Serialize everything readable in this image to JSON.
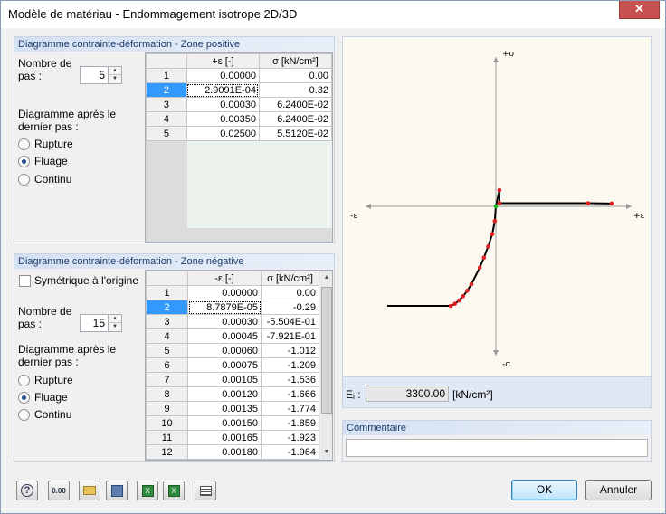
{
  "window": {
    "title": "Modèle de matériau - Endommagement isotrope 2D/3D",
    "close_glyph": "✕"
  },
  "positive": {
    "header": "Diagramme contrainte-déformation - Zone positive",
    "steps_label_1": "Nombre de",
    "steps_label_2": "pas :",
    "steps_value": "5",
    "after_label_1": "Diagramme après le",
    "after_label_2": "dernier pas :",
    "options": [
      "Rupture",
      "Fluage",
      "Continu"
    ],
    "selected_option": "Fluage",
    "columns": [
      "+ε [-]",
      "σ [kN/cm²]"
    ],
    "rows": [
      {
        "n": "1",
        "eps": "0.00000",
        "sigma": "0.00"
      },
      {
        "n": "2",
        "eps": "2.9091E-04",
        "sigma": "0.32"
      },
      {
        "n": "3",
        "eps": "0.00030",
        "sigma": "6.2400E-02"
      },
      {
        "n": "4",
        "eps": "0.00350",
        "sigma": "6.2400E-02"
      },
      {
        "n": "5",
        "eps": "0.02500",
        "sigma": "5.5120E-02"
      }
    ]
  },
  "negative": {
    "header": "Diagramme contrainte-déformation - Zone négative",
    "symmetric_label": "Symétrique à l'origine",
    "symmetric_checked": false,
    "steps_label_1": "Nombre de",
    "steps_label_2": "pas :",
    "steps_value": "15",
    "after_label_1": "Diagramme après le",
    "after_label_2": "dernier pas :",
    "options": [
      "Rupture",
      "Fluage",
      "Continu"
    ],
    "selected_option": "Fluage",
    "columns": [
      "-ε [-]",
      "σ [kN/cm²]"
    ],
    "rows": [
      {
        "n": "1",
        "eps": "0.00000",
        "sigma": "0.00"
      },
      {
        "n": "2",
        "eps": "8.7879E-05",
        "sigma": "-0.29"
      },
      {
        "n": "3",
        "eps": "0.00030",
        "sigma": "-5.504E-01"
      },
      {
        "n": "4",
        "eps": "0.00045",
        "sigma": "-7.921E-01"
      },
      {
        "n": "5",
        "eps": "0.00060",
        "sigma": "-1.012"
      },
      {
        "n": "6",
        "eps": "0.00075",
        "sigma": "-1.209"
      },
      {
        "n": "7",
        "eps": "0.00105",
        "sigma": "-1.536"
      },
      {
        "n": "8",
        "eps": "0.00120",
        "sigma": "-1.666"
      },
      {
        "n": "9",
        "eps": "0.00135",
        "sigma": "-1.774"
      },
      {
        "n": "10",
        "eps": "0.00150",
        "sigma": "-1.859"
      },
      {
        "n": "11",
        "eps": "0.00165",
        "sigma": "-1.923"
      },
      {
        "n": "12",
        "eps": "0.00180",
        "sigma": "-1.964"
      }
    ]
  },
  "plot": {
    "pos_sigma": "+σ",
    "neg_sigma": "-σ",
    "neg_eps": "-ε",
    "pos_eps": "+ε"
  },
  "modulus": {
    "label": "Eᵢ :",
    "value": "3300.00",
    "unit": "[kN/cm²]"
  },
  "comment": {
    "label": "Commentaire",
    "value": ""
  },
  "toolbar": {
    "icons": [
      "help-icon",
      "units-icon",
      "open-icon",
      "save-icon",
      "import-excel-icon",
      "export-excel-icon",
      "table-icon"
    ],
    "values_icon_text": "0.00"
  },
  "buttons": {
    "ok": "OK",
    "cancel": "Annuler"
  },
  "colors": {
    "accent": "#3399ff",
    "header_text": "#1d3b6e",
    "curve": "#000000",
    "points": "#e02020",
    "origin_point": "#22bb22"
  }
}
